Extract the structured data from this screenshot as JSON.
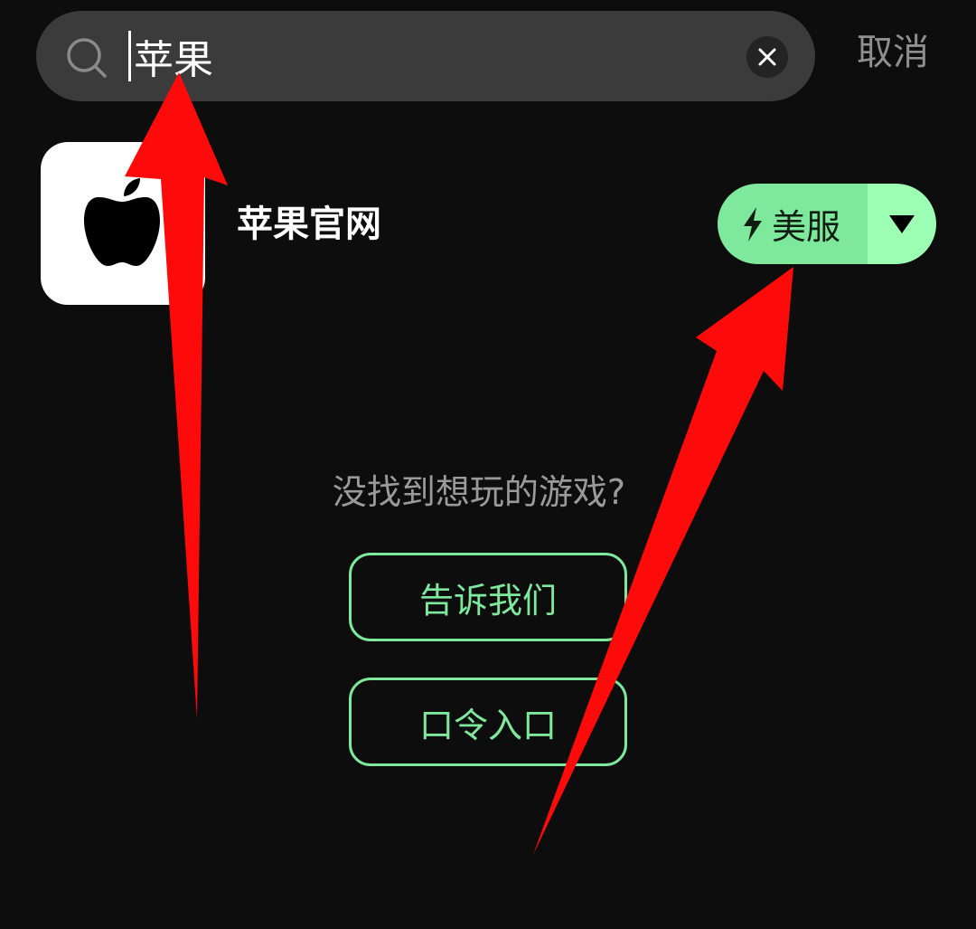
{
  "search": {
    "value": "苹果",
    "cancel_label": "取消"
  },
  "result": {
    "app_name": "苹果官网",
    "icon": "apple-logo-icon",
    "server_label": "美服",
    "server_icon": "lightning-icon",
    "dropdown_icon": "triangle-down-icon"
  },
  "empty_state": {
    "prompt": "没找到想玩的游戏?",
    "feedback_label": "告诉我们",
    "code_entry_label": "口令入口"
  },
  "colors": {
    "background": "#0d0d0d",
    "accent": "#7ee89c",
    "annotation": "#ff0000"
  }
}
